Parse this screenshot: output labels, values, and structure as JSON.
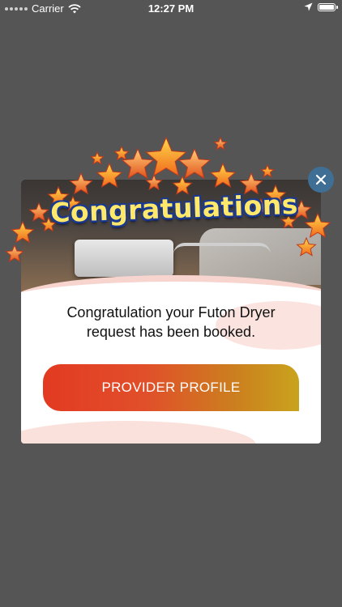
{
  "status_bar": {
    "carrier": "Carrier",
    "time": "12:27 PM"
  },
  "popup": {
    "banner_text": "Congratulations",
    "message": "Congratulation your Futon Dryer request has been booked.",
    "button_label": "PROVIDER PROFILE"
  },
  "colors": {
    "overlay": "#555555",
    "close_button": "#3f6f95",
    "button_start": "#e23a22",
    "button_end": "#c9a31d"
  },
  "icons": [
    "wifi-icon",
    "location-arrow-icon",
    "battery-icon",
    "close-icon",
    "star-icon"
  ]
}
